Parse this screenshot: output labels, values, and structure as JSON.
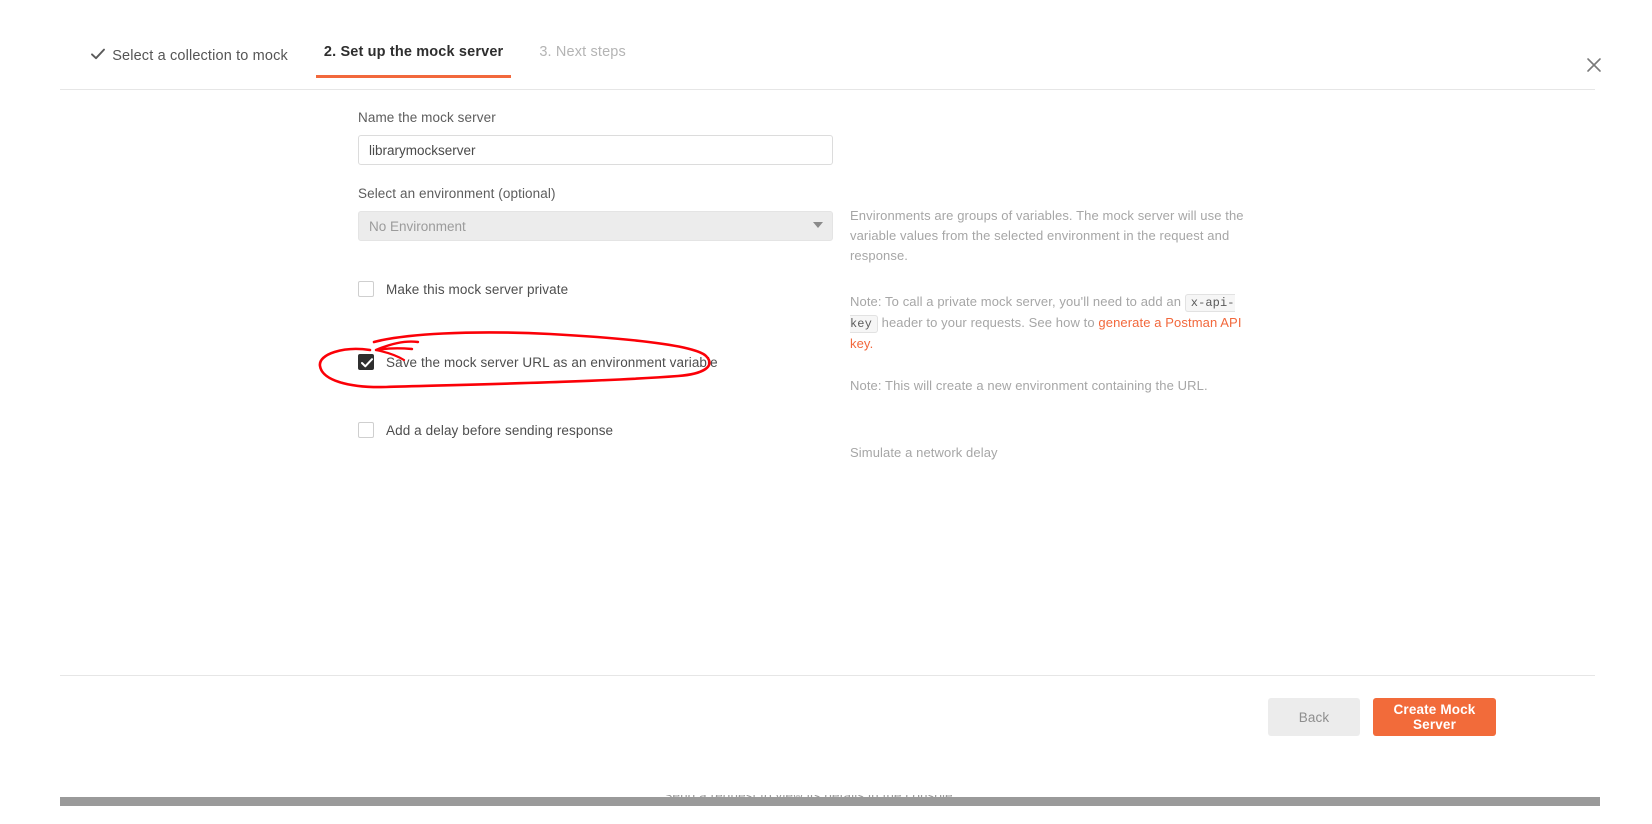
{
  "window": {
    "background_console_text": "Send a request to view its details in the console."
  },
  "header": {
    "tabs": [
      {
        "label": "Select a collection to mock",
        "state": "done",
        "icon": "check-icon"
      },
      {
        "label": "2. Set up the mock server",
        "state": "active"
      },
      {
        "label": "3. Next steps",
        "state": "upcoming"
      }
    ],
    "close_icon": "close-icon"
  },
  "form": {
    "name_label": "Name the mock server",
    "name_value": "librarymockserver",
    "name_placeholder": "Name the mock server",
    "environment_label": "Select an environment (optional)",
    "environment_value": "No Environment",
    "checkboxes": [
      {
        "label": "Make this mock server private",
        "checked": false
      },
      {
        "label": "Save the mock server URL as an environment variable",
        "checked": true
      },
      {
        "label": "Add a delay before sending response",
        "checked": false
      }
    ]
  },
  "help": {
    "environment_note": "Environments are groups of variables. The mock server will use the variable values from the selected environment in the request and response.",
    "private_note_part1": "Note: To call a private mock server, you'll need to add an ",
    "private_note_code": "x-api-key",
    "private_note_part2": " header to your requests. See how to ",
    "private_note_link": "generate a Postman API key",
    "private_note_end": ".",
    "url_env_note": "Note: This will create a new environment containing the URL.",
    "delay_note": "Simulate a network delay"
  },
  "footer": {
    "back_label": "Back",
    "create_label": "Create Mock Server"
  },
  "colors": {
    "accent": "#f26b3a",
    "tab_underline": "#f2683c",
    "annotation": "#fb0007",
    "link": "#f2683c"
  },
  "annotation": {
    "shape": "hand-drawn-ellipse-with-arrow",
    "target": "Save the mock server URL as an environment variable"
  }
}
